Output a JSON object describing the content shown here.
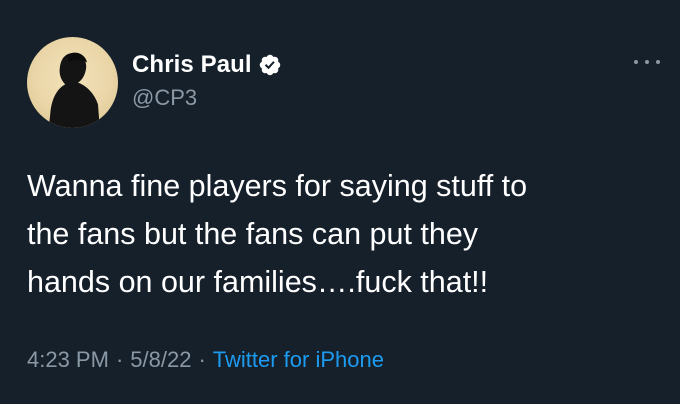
{
  "author": {
    "display_name": "Chris Paul",
    "handle": "@CP3",
    "verified": true,
    "avatar_icon": "person-silhouette-avatar"
  },
  "tweet": {
    "text": "Wanna fine players for saying stuff to\nthe fans but the fans can put they\nhands on our families….fuck that!!"
  },
  "meta": {
    "time": "4:23 PM",
    "separator": "·",
    "date": "5/8/22",
    "source": "Twitter for iPhone"
  },
  "icons": {
    "more": "more-horizontal-icon",
    "verified": "verified-badge-icon"
  },
  "colors": {
    "background": "#15202b",
    "primary_text": "#ffffff",
    "secondary_text": "#8b98a5",
    "accent": "#1d9bf0"
  }
}
